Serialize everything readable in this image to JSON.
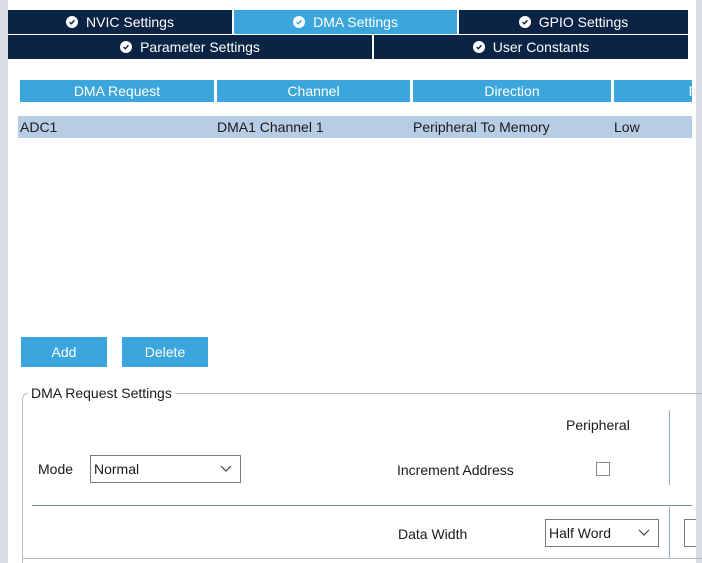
{
  "tabs": {
    "row1": [
      {
        "label": "NVIC Settings",
        "active": false
      },
      {
        "label": "DMA Settings",
        "active": true
      },
      {
        "label": "GPIO Settings",
        "active": false
      }
    ],
    "row2": [
      {
        "label": "Parameter Settings",
        "active": false
      },
      {
        "label": "User Constants",
        "active": false
      }
    ]
  },
  "dma_table": {
    "columns": [
      "DMA Request",
      "Channel",
      "Direction",
      "P"
    ],
    "rows": [
      [
        "ADC1",
        "DMA1 Channel 1",
        "Peripheral To Memory",
        "Low"
      ]
    ]
  },
  "buttons": {
    "add": "Add",
    "delete": "Delete"
  },
  "settings": {
    "group_title": "DMA Request Settings",
    "mode_label": "Mode",
    "mode_value": "Normal",
    "peripheral_header": "Peripheral",
    "increment_address_label": "Increment Address",
    "increment_address_checked": false,
    "data_width_label": "Data Width",
    "data_width_value": "Half Word"
  },
  "colors": {
    "tab_dark": "#0b2344",
    "accent": "#3aa6dc",
    "row_selected": "#b7cde6"
  },
  "icons": {
    "tab_status": "check-circle-icon",
    "dropdown": "chevron-down-icon"
  }
}
